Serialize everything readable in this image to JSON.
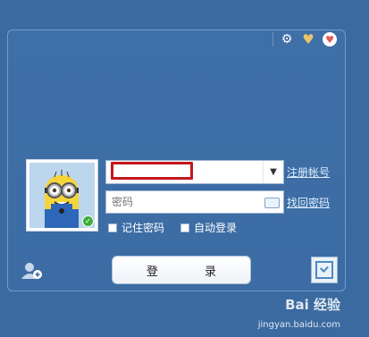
{
  "window": {
    "top_icons": [
      {
        "name": "settings-icon",
        "glyph": "⚙"
      },
      {
        "name": "heart-icon",
        "glyph": "♥"
      },
      {
        "name": "mood-icon",
        "glyph": "♥"
      }
    ]
  },
  "login": {
    "account_value": "",
    "dropdown_glyph": "▼",
    "password_placeholder": "密码",
    "register_link": "注册帐号",
    "recover_link": "找回密码",
    "remember_password": "记住密码",
    "auto_login": "自动登录",
    "login_button": "登 录"
  },
  "avatar": {
    "status": "online"
  },
  "watermark": {
    "brand": "Bai 经验",
    "url": "jingyan.baidu.com"
  },
  "colors": {
    "background": "#3a6aa0",
    "highlight": "#c4161c"
  }
}
